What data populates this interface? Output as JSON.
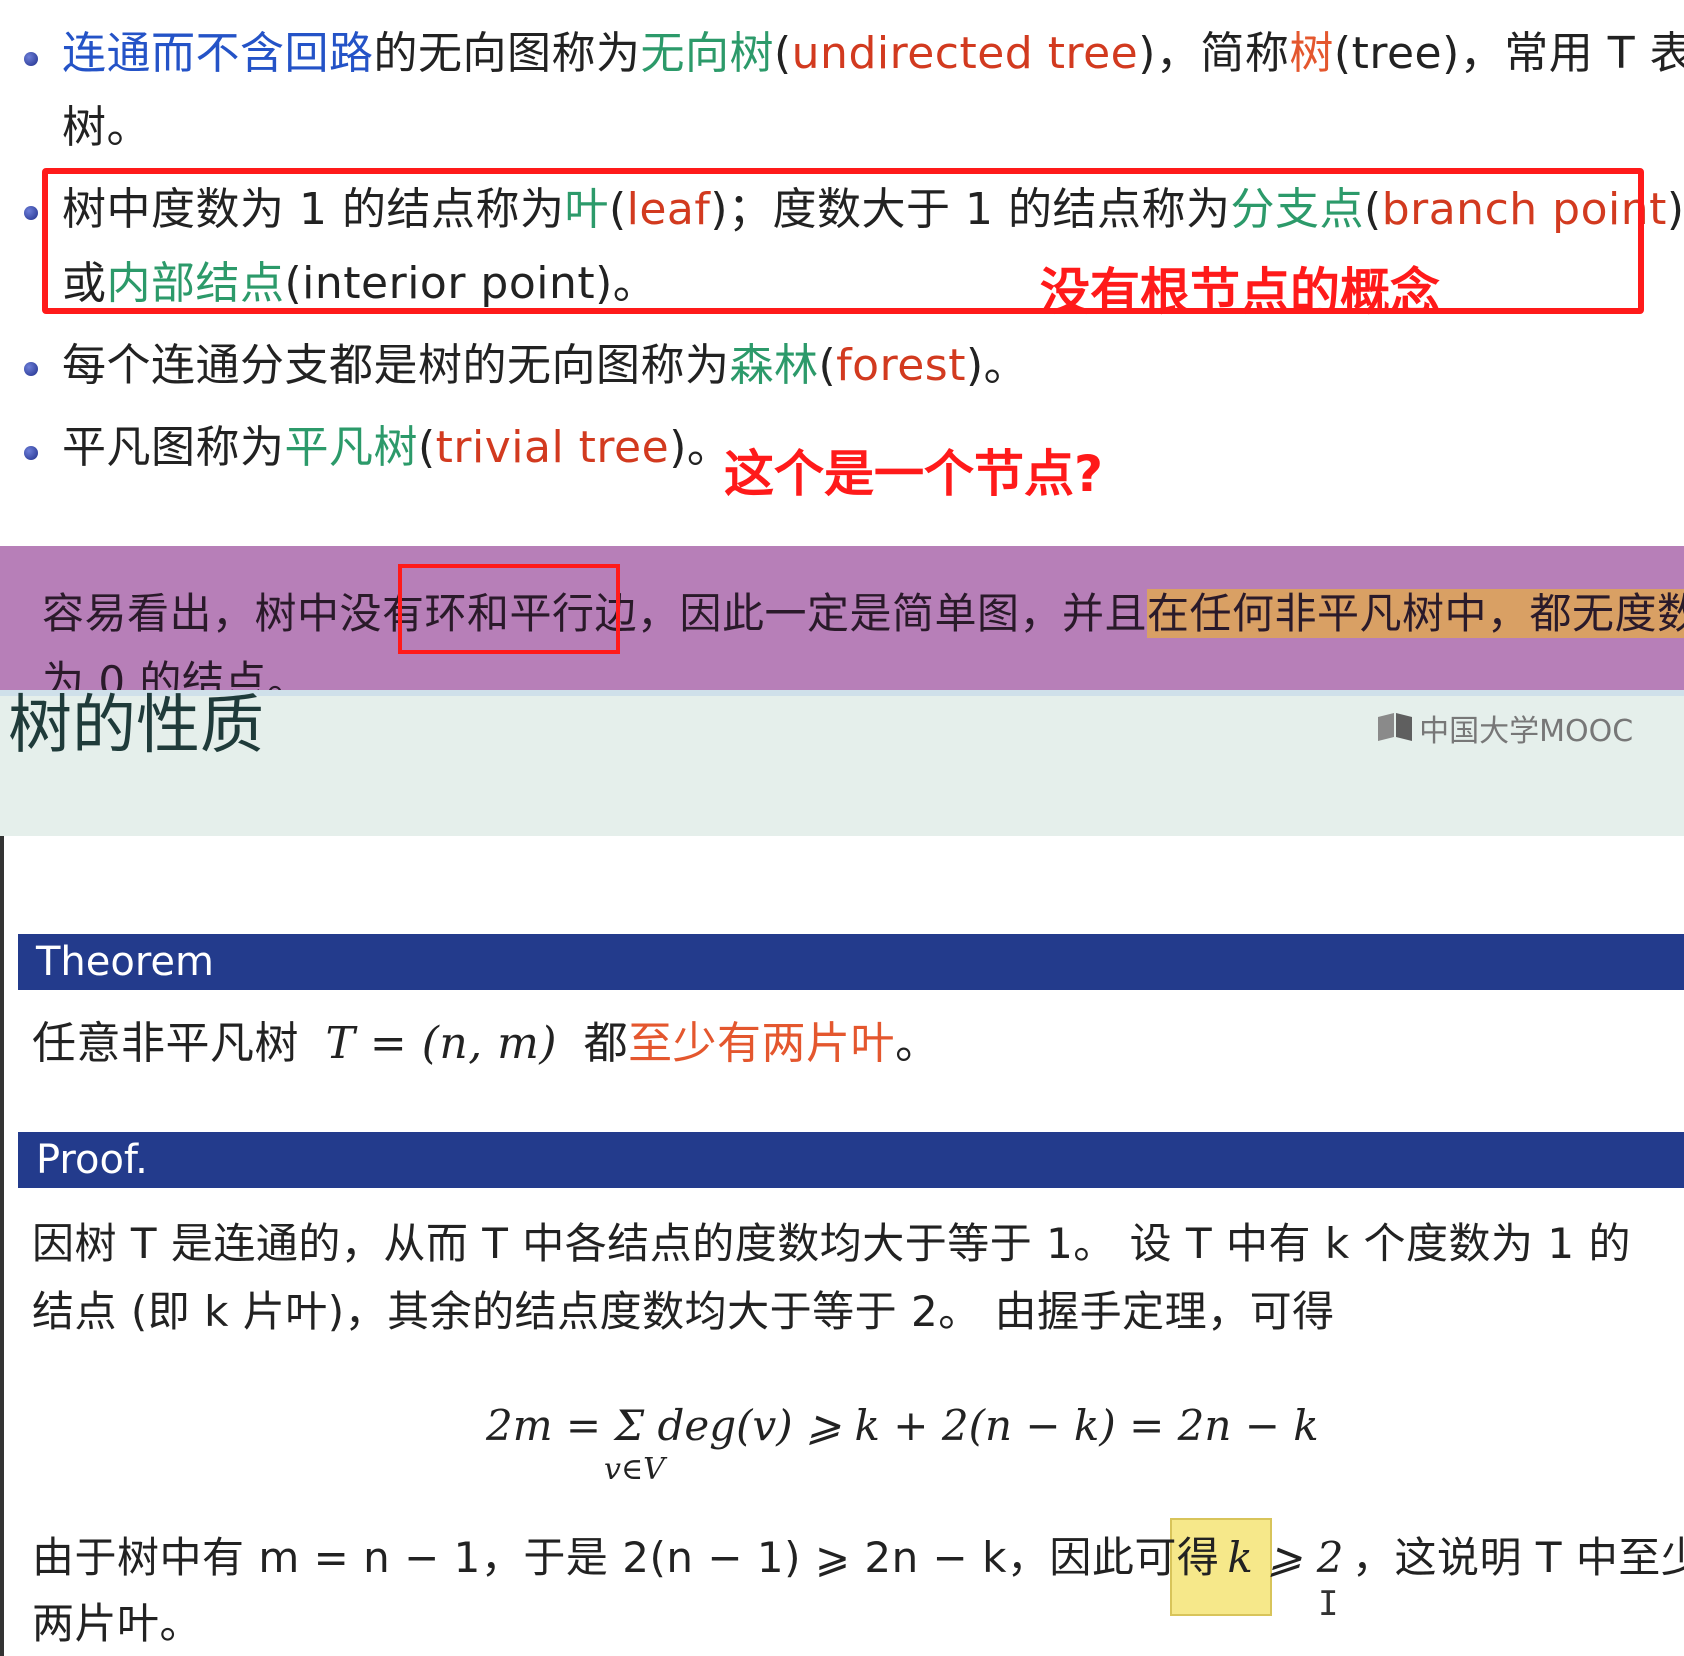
{
  "bullets": {
    "b1": {
      "line1": [
        {
          "t": "连通而不含回路",
          "c": "blue"
        },
        {
          "t": "的无向图称为",
          "c": "plain"
        },
        {
          "t": "无向树",
          "c": "green"
        },
        {
          "t": "(",
          "c": "plain"
        },
        {
          "t": "undirected tree",
          "c": "red"
        },
        {
          "t": ")，简称",
          "c": "plain"
        },
        {
          "t": "树",
          "c": "orange"
        },
        {
          "t": "(tree)，常用 T 表示",
          "c": "plain"
        }
      ],
      "line2": "树。"
    },
    "b2": {
      "line1": [
        {
          "t": "树中度数为 1 的结点称为",
          "c": "plain"
        },
        {
          "t": "叶",
          "c": "green"
        },
        {
          "t": "(",
          "c": "plain"
        },
        {
          "t": "leaf",
          "c": "red"
        },
        {
          "t": ")；度数大于 1 的结点称为",
          "c": "plain"
        },
        {
          "t": "分支点",
          "c": "green"
        },
        {
          "t": "(",
          "c": "plain"
        },
        {
          "t": "branch point",
          "c": "red"
        },
        {
          "t": ")",
          "c": "plain"
        }
      ],
      "line2": [
        {
          "t": "或",
          "c": "plain"
        },
        {
          "t": "内部结点",
          "c": "green"
        },
        {
          "t": "(interior point)。",
          "c": "plain"
        }
      ]
    },
    "b3": [
      {
        "t": "每个连通分支都是树的无向图称为",
        "c": "plain"
      },
      {
        "t": "森林",
        "c": "green"
      },
      {
        "t": "(",
        "c": "plain"
      },
      {
        "t": "forest",
        "c": "red"
      },
      {
        "t": ")。",
        "c": "plain"
      }
    ],
    "b4": [
      {
        "t": "平凡图称为",
        "c": "plain"
      },
      {
        "t": "平凡树",
        "c": "green"
      },
      {
        "t": "(",
        "c": "plain"
      },
      {
        "t": "trivial tree",
        "c": "red"
      },
      {
        "t": ")。",
        "c": "plain"
      }
    ]
  },
  "annotations": {
    "no_root": "没有根节点的概念",
    "single_node": "这个是一个节点?"
  },
  "purple_box": {
    "part1": "容易看出，树中没有",
    "boxed": "环和平行边",
    "part2": "，因此一定是简单图，并且",
    "highlight": "在任何非平凡树中，都无度数",
    "line2": "为 0 的结点。"
  },
  "slide": {
    "title": "树的性质",
    "logo": "中国大学MOOC",
    "theorem_label": "Theorem",
    "theorem_prefix": "任意非平凡树",
    "theorem_formula": "T = (n, m)",
    "theorem_du": "都",
    "theorem_highlight": "至少有两片叶",
    "theorem_end": "。",
    "proof_label": "Proof.",
    "proof_line1": "因树 T 是连通的，从而 T 中各结点的度数均大于等于 1。 设 T 中有 k 个度数为 1 的",
    "proof_line2": "结点 (即 k 片叶)，其余的结点度数均大于等于 2。   由握手定理，可得",
    "equation": "2m = Σ deg(v) ⩾ k + 2(n − k) = 2n − k",
    "equation_sub": "v∈V",
    "conclusion_part1": "由于树中有 m = n − 1，于是 2(n − 1) ⩾ 2n − k，因此可得",
    "conclusion_highlight": "k ⩾ 2",
    "conclusion_part2": "，这说明 T 中至少有",
    "conclusion_line2": "两片叶。"
  },
  "colors": {
    "blue_text": "#2453c7",
    "green_text": "#2c9a6a",
    "red_text": "#d23a1f",
    "annotation_red": "#ff1a1a",
    "purple_bg": "#b77fb8",
    "orange_highlight": "#d9a064",
    "navy_bar": "#233b8c",
    "yellow_highlight": "#f6e88a"
  }
}
